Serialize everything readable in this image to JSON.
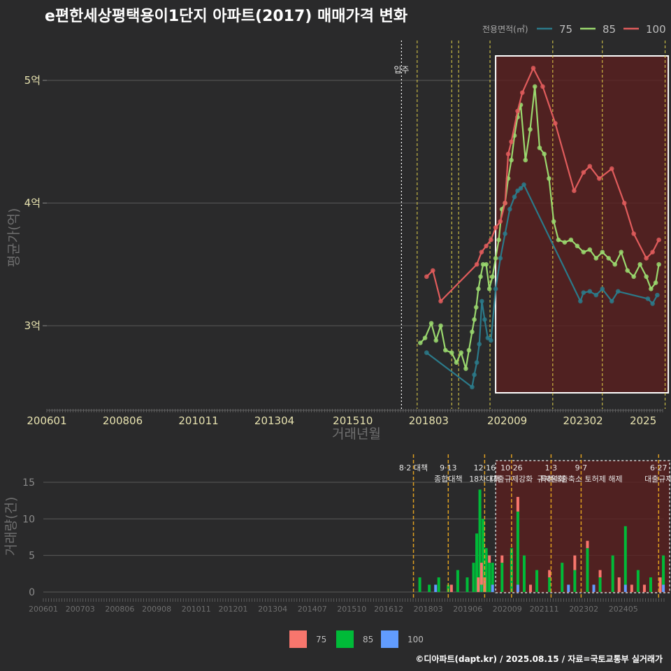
{
  "title": "e편한세상평택용이1단지 아파트(2017) 매매가격 변화",
  "credit": "©디아파트(dapt.kr) / 2025.08.15 / 자료=국토교통부 실거래가",
  "colors": {
    "background": "#2a2a2b",
    "s75": "#2b7a8a",
    "s85": "#9ad86e",
    "s100": "#e05c5c",
    "v75": "#f8766d",
    "v85": "#00ba38",
    "v100": "#619cff",
    "vline": "#e3d34a",
    "vline_vol": "#e0a020",
    "shade": "#5a1f1f",
    "box": "#ffffff"
  },
  "chart_data": [
    {
      "type": "line",
      "title": "e편한세상평택용이1단지 아파트(2017) 매매가격 변화",
      "xlabel": "거래년월",
      "ylabel": "평균가(억)",
      "x_ticks": [
        "200601",
        "200806",
        "201011",
        "201304",
        "201510",
        "201803",
        "202009",
        "202302",
        "2025"
      ],
      "y_ticks": [
        "3억",
        "4억",
        "5억"
      ],
      "ylim": [
        2.42,
        5.3
      ],
      "legend": {
        "title": "전용면적(㎡)",
        "entries": [
          "75",
          "85",
          "100"
        ],
        "position": "top-right"
      },
      "annotations": [
        {
          "label": "입주",
          "x": "2017.3"
        }
      ],
      "event_lines": [
        "2017.8",
        "2018.9",
        "2019.12",
        "2020.12",
        "2022.12",
        "2023.7",
        "2025.7"
      ],
      "highlight_range": [
        "2020.3",
        "2025.8"
      ],
      "series": [
        {
          "name": "75",
          "x": [
            2018.1,
            2019.55,
            2019.62,
            2019.7,
            2019.78,
            2019.86,
            2019.95,
            2020.05,
            2020.15,
            2020.3,
            2020.45,
            2020.6,
            2020.75,
            2020.9,
            2021.0,
            2021.1,
            2021.2,
            2023.0,
            2023.1,
            2023.3,
            2023.5,
            2023.7,
            2024.0,
            2024.2,
            2025.15,
            2025.3,
            2025.45
          ],
          "y": [
            2.78,
            2.5,
            2.6,
            2.7,
            2.85,
            3.2,
            3.05,
            2.9,
            2.88,
            3.3,
            3.55,
            3.75,
            3.95,
            4.05,
            4.1,
            4.12,
            4.15,
            3.2,
            3.27,
            3.28,
            3.25,
            3.3,
            3.2,
            3.28,
            3.22,
            3.18,
            3.25
          ]
        },
        {
          "name": "85",
          "x": [
            2017.9,
            2018.05,
            2018.25,
            2018.4,
            2018.55,
            2018.7,
            2018.9,
            2019.05,
            2019.2,
            2019.35,
            2019.45,
            2019.55,
            2019.62,
            2019.68,
            2019.75,
            2019.82,
            2019.9,
            2020.0,
            2020.1,
            2020.2,
            2020.3,
            2020.4,
            2020.5,
            2020.6,
            2020.7,
            2020.8,
            2020.9,
            2021.0,
            2021.1,
            2021.25,
            2021.4,
            2021.55,
            2021.7,
            2021.85,
            2022.0,
            2022.15,
            2022.3,
            2022.5,
            2022.7,
            2022.9,
            2023.1,
            2023.3,
            2023.5,
            2023.7,
            2023.9,
            2024.1,
            2024.3,
            2024.5,
            2024.7,
            2024.9,
            2025.1,
            2025.25,
            2025.4,
            2025.5
          ],
          "y": [
            2.86,
            2.9,
            3.02,
            2.88,
            3.0,
            2.8,
            2.78,
            2.7,
            2.78,
            2.65,
            2.8,
            2.95,
            3.05,
            3.15,
            3.3,
            3.4,
            3.5,
            3.5,
            3.3,
            3.4,
            3.55,
            3.7,
            3.95,
            4.0,
            4.2,
            4.35,
            4.55,
            4.7,
            4.8,
            4.35,
            4.6,
            4.95,
            4.45,
            4.4,
            4.2,
            3.85,
            3.7,
            3.68,
            3.7,
            3.65,
            3.6,
            3.62,
            3.55,
            3.6,
            3.55,
            3.5,
            3.6,
            3.45,
            3.4,
            3.5,
            3.4,
            3.3,
            3.35,
            3.5
          ]
        },
        {
          "name": "100",
          "x": [
            2018.1,
            2018.3,
            2018.55,
            2019.7,
            2019.85,
            2020.0,
            2020.15,
            2020.3,
            2020.45,
            2020.6,
            2020.7,
            2020.8,
            2021.0,
            2021.15,
            2021.5,
            2021.8,
            2022.2,
            2022.8,
            2023.1,
            2023.3,
            2023.6,
            2024.0,
            2024.4,
            2024.7,
            2025.1,
            2025.3,
            2025.5
          ],
          "y": [
            3.4,
            3.45,
            3.2,
            3.5,
            3.6,
            3.65,
            3.7,
            3.8,
            3.85,
            4.0,
            4.4,
            4.5,
            4.75,
            4.9,
            5.1,
            4.95,
            4.65,
            4.1,
            4.25,
            4.3,
            4.2,
            4.28,
            4.0,
            3.75,
            3.55,
            3.6,
            3.7
          ]
        }
      ]
    },
    {
      "type": "bar",
      "ylabel": "거래량(건)",
      "x_ticks": [
        "200601",
        "200703",
        "200806",
        "200908",
        "201011",
        "201201",
        "201304",
        "201407",
        "201510",
        "201612",
        "201803",
        "201906",
        "202009",
        "202111",
        "202302",
        "202405",
        "20250"
      ],
      "y_ticks": [
        "0",
        "5",
        "10",
        "15"
      ],
      "ylim": [
        0,
        18
      ],
      "legend": {
        "entries": [
          "75",
          "85",
          "100"
        ],
        "position": "bottom"
      },
      "events": [
        {
          "x": "2017.7",
          "lines": [
            "8·2 대책"
          ]
        },
        {
          "x": "2018.8",
          "lines": [
            "9·13",
            "종합대책"
          ]
        },
        {
          "x": "2019.95",
          "lines": [
            "12·16",
            "18차대책"
          ]
        },
        {
          "x": "2020.8",
          "lines": [
            "10·26",
            "대출규제강화"
          ]
        },
        {
          "x": "2022.05",
          "lines": [
            "1·3",
            "규제완화"
          ]
        },
        {
          "x": "2023.0",
          "lines": [
            "9·7",
            "특례대출축소 토허제 해제"
          ]
        },
        {
          "x": "2025.45",
          "lines": [
            "6·27",
            "대출규제"
          ]
        }
      ],
      "highlight_range": [
        "2020.3",
        "2025.8"
      ],
      "series": [
        {
          "name": "75",
          "x": [
            2018.9,
            2019.75,
            2019.85,
            2019.95,
            2020.1,
            2020.5,
            2021.0,
            2021.4,
            2022.0,
            2022.8,
            2023.2,
            2023.6,
            2024.2,
            2024.6,
            2025.0,
            2025.5
          ],
          "values": [
            1,
            2,
            3,
            2,
            1,
            1,
            2,
            1,
            1,
            2,
            1,
            1,
            2,
            1,
            1,
            2
          ]
        },
        {
          "name": "85",
          "x": [
            2017.9,
            2018.2,
            2018.5,
            2018.8,
            2019.1,
            2019.4,
            2019.6,
            2019.7,
            2019.8,
            2019.9,
            2020.0,
            2020.1,
            2020.2,
            2020.5,
            2020.8,
            2021.0,
            2021.2,
            2021.6,
            2022.0,
            2022.4,
            2022.8,
            2023.2,
            2023.6,
            2024.0,
            2024.4,
            2024.8,
            2025.2,
            2025.6
          ],
          "values": [
            2,
            1,
            2,
            1,
            3,
            2,
            4,
            8,
            14,
            10,
            6,
            4,
            3,
            4,
            6,
            10,
            5,
            3,
            2,
            4,
            3,
            6,
            2,
            5,
            8,
            3,
            2,
            4
          ]
        },
        {
          "name": "100",
          "x": [
            2018.4,
            2019.85,
            2020.2,
            2021.0,
            2022.6,
            2023.4,
            2024.4,
            2025.6
          ],
          "values": [
            1,
            1,
            1,
            1,
            1,
            1,
            1,
            1
          ]
        }
      ]
    }
  ]
}
